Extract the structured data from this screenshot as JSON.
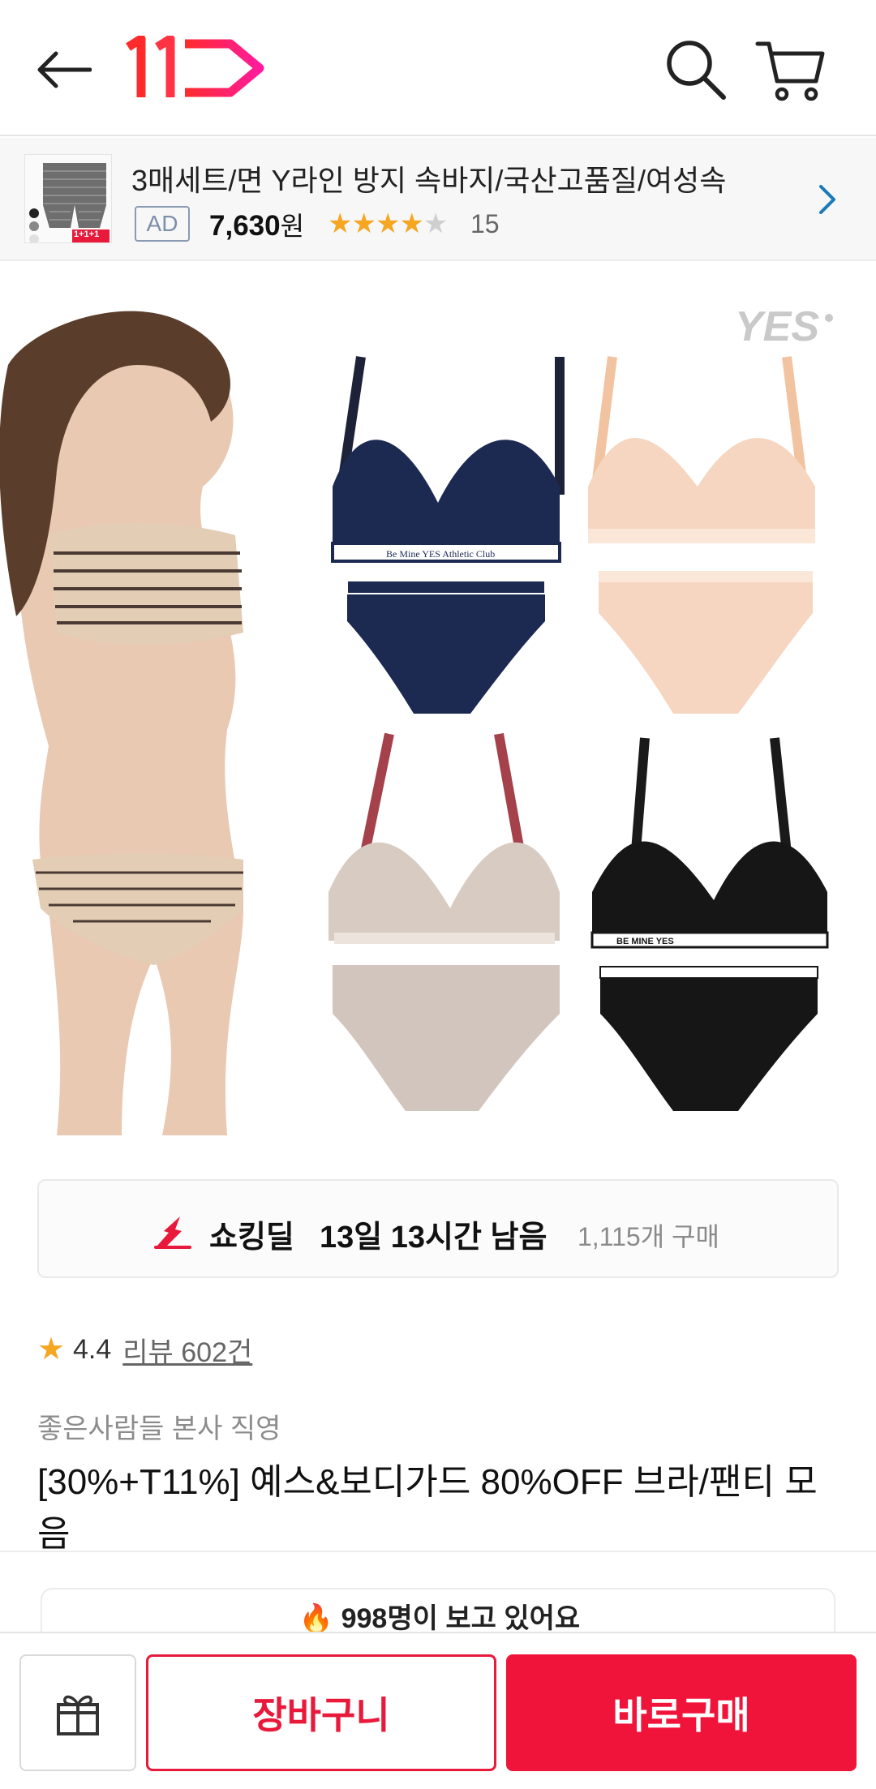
{
  "header": {
    "back_icon": "arrow-left-icon",
    "logo_text": "11",
    "search_icon": "search-icon",
    "cart_icon": "cart-icon"
  },
  "ad": {
    "title": "3매세트/면 Y라인 방지 속바지/국산고품질/여성속",
    "badge": "AD",
    "price": "7,630",
    "price_unit": "원",
    "rating_stars": 4,
    "review_count": "15",
    "thumb_label": "1+1+1"
  },
  "product_image": {
    "brand_watermark": "YES",
    "band_text_navy": "Be Mine YES Athletic Club",
    "band_text_black": "BE MINE YES"
  },
  "deal": {
    "name": "쇼킹딜",
    "time_left": "13일 13시간 남음",
    "purchase_count": "1,115개 구매"
  },
  "rating": {
    "value": "4.4",
    "review_link": "리뷰 602건"
  },
  "seller": "좋은사람들 본사 직영",
  "product_title": "[30%+T11%] 예스&보디가드 80%OFF 브라/팬티 모음",
  "viewers": "🔥 998명이 보고 있어요",
  "bottom": {
    "gift_icon": "gift-icon",
    "cart_label": "장바구니",
    "buy_label": "바로구매"
  },
  "colors": {
    "brand_red": "#f0143b",
    "star": "#f5a623"
  }
}
